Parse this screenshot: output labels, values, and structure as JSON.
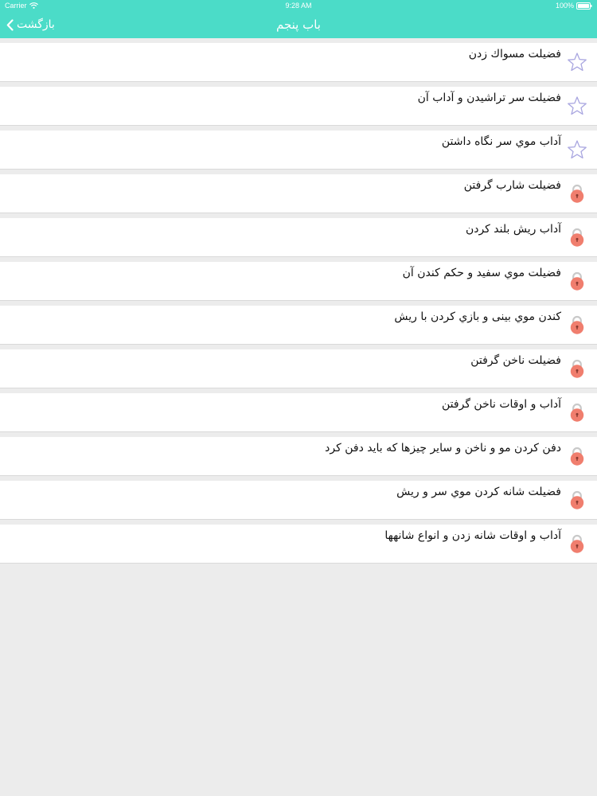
{
  "status_bar": {
    "carrier": "Carrier",
    "time": "9:28 AM",
    "battery": "100%"
  },
  "nav": {
    "back_label": "بازگشت",
    "title": "باب پنجم"
  },
  "colors": {
    "accent": "#4bdcc8",
    "star": "#a9a6e0",
    "lock": "#f07e6e"
  },
  "items": [
    {
      "label": "فضيلت مسواك زدن",
      "icon": "star-icon"
    },
    {
      "label": "فضيلت سر تراشيدن و آداب آن",
      "icon": "star-icon"
    },
    {
      "label": "آداب موي سر نگاه داشتن",
      "icon": "star-icon"
    },
    {
      "label": "فضيلت شارب گرفتن",
      "icon": "lock-icon"
    },
    {
      "label": "آداب ريش بلند كردن",
      "icon": "lock-icon"
    },
    {
      "label": "فضيلت موي سفيد و حكم كندن آن",
      "icon": "lock-icon"
    },
    {
      "label": "كندن موي بينى و بازي كردن با ريش",
      "icon": "lock-icon"
    },
    {
      "label": "فضيلت ناخن گرفتن",
      "icon": "lock-icon"
    },
    {
      "label": "آداب و اوقات ناخن گرفتن",
      "icon": "lock-icon"
    },
    {
      "label": "دفن كردن مو و ناخن و ساير چيزها كه بايد دفن كرد",
      "icon": "lock-icon"
    },
    {
      "label": "فضيلت شانه كردن موي سر و ريش",
      "icon": "lock-icon"
    },
    {
      "label": "آداب و اوقات شانه زدن و انواع شانهها",
      "icon": "lock-icon"
    }
  ]
}
